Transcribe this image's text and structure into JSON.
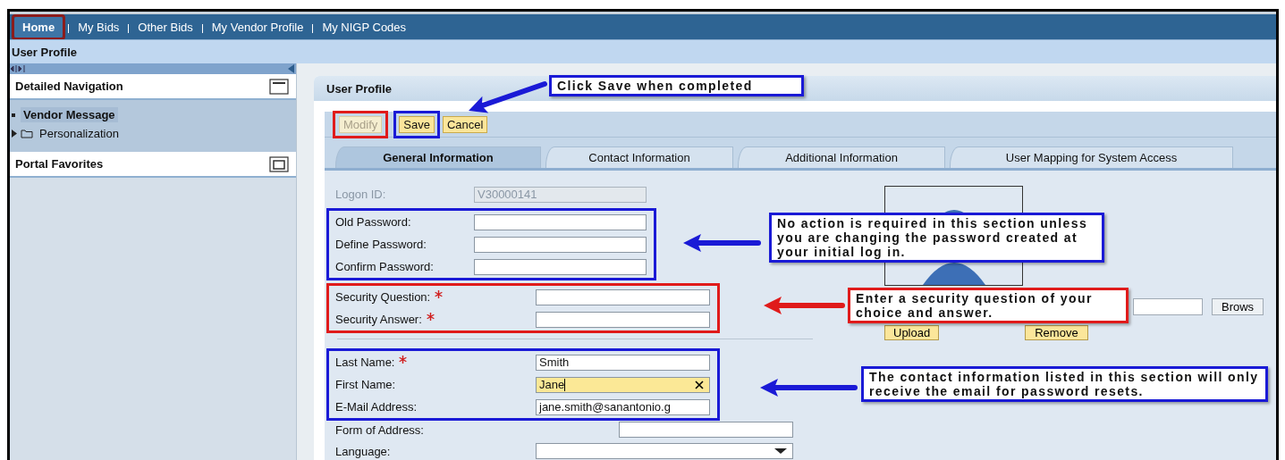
{
  "top_nav": [
    {
      "label": "Home",
      "selected": true,
      "color": "#8b1c1c"
    },
    {
      "label": "My Bids",
      "selected": false
    },
    {
      "label": "Other Bids",
      "selected": false
    },
    {
      "label": "My Vendor Profile",
      "selected": false
    },
    {
      "label": "My NIGP Codes",
      "selected": false
    }
  ],
  "breadcrumb": "User Profile",
  "sidebar": {
    "panels": [
      {
        "title": "Detailed Navigation",
        "expanded": true,
        "items": [
          {
            "label": "Vendor Message",
            "kind": "page",
            "selected": true
          },
          {
            "label": "Personalization",
            "kind": "folder",
            "selected": false
          }
        ]
      },
      {
        "title": "Portal Favorites",
        "expanded": false
      }
    ]
  },
  "panel": {
    "title": "User Profile",
    "buttons": [
      {
        "label": "Modify",
        "disabled": true,
        "color": "#e01b1b"
      },
      {
        "label": "Save",
        "disabled": false,
        "color": "#1a1ad6"
      },
      {
        "label": "Cancel",
        "disabled": false
      }
    ],
    "tabs": [
      {
        "label": "General Information",
        "selected": true
      },
      {
        "label": "Contact Information",
        "selected": false
      },
      {
        "label": "Additional Information",
        "selected": false
      },
      {
        "label": "User Mapping for System Access",
        "selected": false
      }
    ],
    "form_groups": [
      {
        "fields": [
          {
            "label": "Logon ID:",
            "kind": "text",
            "value": "V30000141",
            "required": false,
            "disabled": true,
            "focused": false
          }
        ]
      },
      {
        "color": "#1a1ad6",
        "fields": [
          {
            "label": "Old Password:",
            "kind": "text",
            "required": false,
            "disabled": false,
            "focused": false
          },
          {
            "label": "Define Password:",
            "kind": "text",
            "required": false,
            "disabled": false,
            "focused": false
          },
          {
            "label": "Confirm Password:",
            "kind": "text",
            "required": false,
            "disabled": false,
            "focused": false
          }
        ]
      },
      {
        "color": "#e01b1b",
        "fields": [
          {
            "label": "Security Question:",
            "kind": "text",
            "required": true,
            "disabled": false,
            "focused": false
          },
          {
            "label": "Security Answer:",
            "kind": "text",
            "required": true,
            "disabled": false,
            "focused": false
          }
        ]
      },
      {
        "color": "#1a1ad6",
        "fields": [
          {
            "label": "Last Name:",
            "kind": "text",
            "value": "Smith",
            "required": true,
            "disabled": false,
            "focused": false
          },
          {
            "label": "First Name:",
            "kind": "text",
            "value": "Jane",
            "required": false,
            "disabled": false,
            "focused": true
          },
          {
            "label": "E-Mail Address:",
            "kind": "text",
            "value": "jane.smith@sanantonio.g",
            "required": false,
            "disabled": false,
            "focused": false
          }
        ]
      },
      {
        "fields": [
          {
            "label": "Form of Address:",
            "kind": "text",
            "required": false,
            "disabled": false,
            "focused": false
          },
          {
            "label": "Language:",
            "kind": "select",
            "required": false,
            "disabled": false,
            "focused": false
          }
        ]
      }
    ],
    "photo": {
      "browse_button": "Brows",
      "buttons": [
        "Upload",
        "Remove"
      ]
    }
  },
  "callouts": [
    {
      "text": "Click Save when completed",
      "color": "#1a1ad6"
    },
    {
      "text": "No action is required in this section unless you are changing the password created at your initial log in.",
      "color": "#1a1ad6"
    },
    {
      "text": "Enter a security question of your choice and answer.",
      "color": "#e01b1b"
    },
    {
      "text": "The contact information listed in this section will only receive the email for password resets.",
      "color": "#1a1ad6"
    }
  ]
}
